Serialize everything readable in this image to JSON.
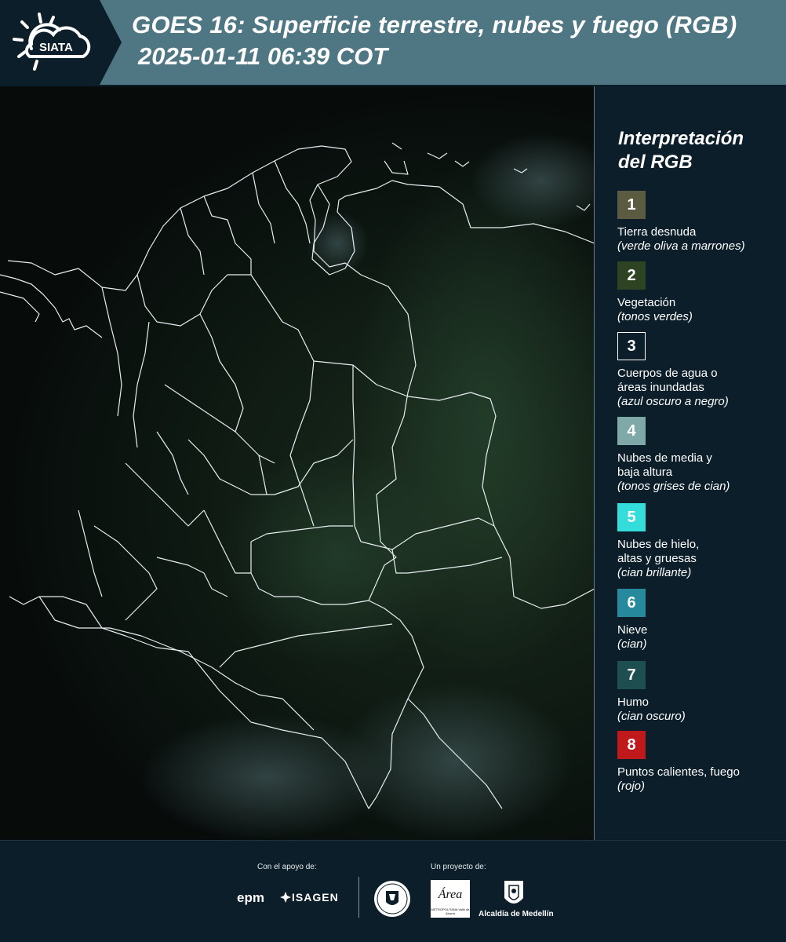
{
  "header": {
    "logo_text": "SIATA",
    "title_line1": "GOES 16: Superficie terrestre, nubes y fuego (RGB)",
    "title_line2": "2025-01-11 06:39 COT"
  },
  "legend": {
    "title_line1": "Interpretación",
    "title_line2": "del RGB",
    "items": [
      {
        "num": "1",
        "color": "#5b5b42",
        "label_lines": [
          "Tierra desnuda"
        ],
        "desc": "(verde oliva a marrones)"
      },
      {
        "num": "2",
        "color": "#2d4322",
        "label_lines": [
          "Vegetación"
        ],
        "desc": "(tonos verdes)"
      },
      {
        "num": "3",
        "color": "#0c1e2a",
        "label_lines": [
          "Cuerpos de agua o",
          "áreas inundadas"
        ],
        "desc": "(azul oscuro a negro)"
      },
      {
        "num": "4",
        "color": "#7fa9a8",
        "label_lines": [
          "Nubes de media y",
          "baja altura"
        ],
        "desc": "(tonos grises de cian)"
      },
      {
        "num": "5",
        "color": "#35ddda",
        "label_lines": [
          "Nubes de hielo,",
          "altas y gruesas"
        ],
        "desc": "(cian brillante)"
      },
      {
        "num": "6",
        "color": "#268a9c",
        "label_lines": [
          "Nieve"
        ],
        "desc": "(cian)"
      },
      {
        "num": "7",
        "color": "#1e4e4f",
        "label_lines": [
          "Humo"
        ],
        "desc": "(cian oscuro)"
      },
      {
        "num": "8",
        "color": "#c0191b",
        "label_lines": [
          "Puntos calientes, fuego"
        ],
        "desc": "(rojo)"
      }
    ]
  },
  "footer": {
    "support_caption": "Con el apoyo de:",
    "project_caption": "Un proyecto de:",
    "epm_text": "epm",
    "isagen_text": "ISAGEN",
    "area_text": "Área",
    "area_sub": "METROPOLITANA Valle de Aburrá",
    "medellin_text": "Alcaldía de Medellín"
  }
}
